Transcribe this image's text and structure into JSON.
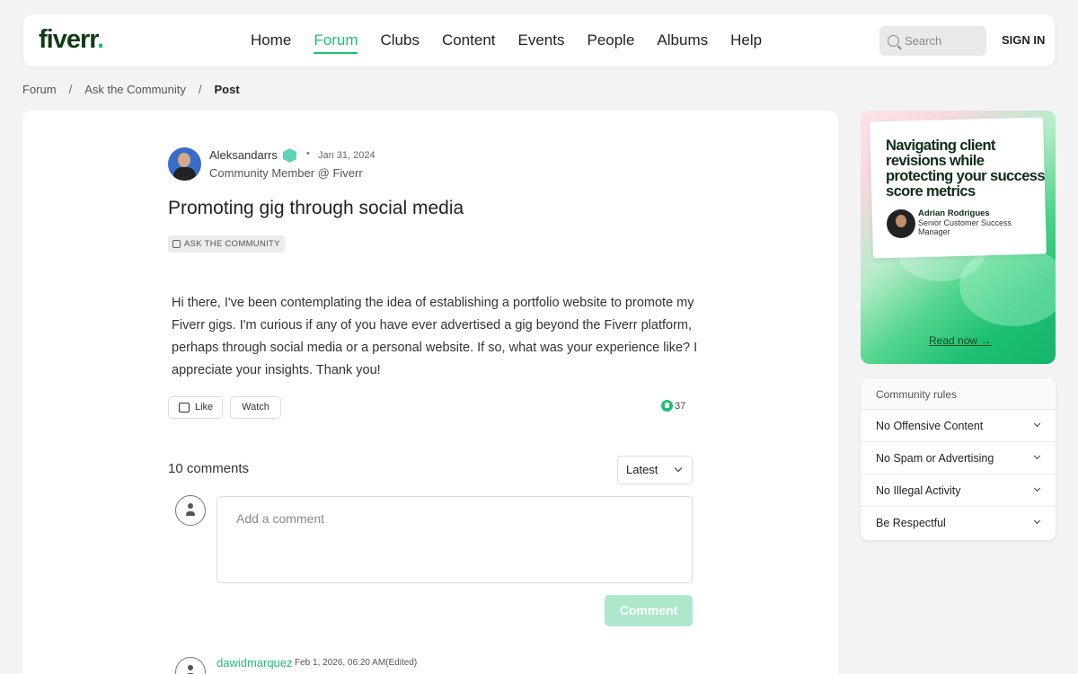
{
  "header": {
    "logo": "fiverr",
    "logo_dot": ".",
    "nav": [
      "Home",
      "Forum",
      "Clubs",
      "Content",
      "Events",
      "People",
      "Albums",
      "Help"
    ],
    "active_nav": "Forum",
    "search_placeholder": "Search",
    "signin": "SIGN IN"
  },
  "breadcrumb": {
    "items": [
      "Forum",
      "Ask the Community",
      "Post"
    ],
    "separator": "/"
  },
  "post": {
    "author": "Aleksandarrs",
    "dot": "•",
    "date": "Jan 31, 2024",
    "role": "Community Member @ Fiverr",
    "title": "Promoting gig through social media",
    "tag": "ASK THE COMMUNITY",
    "body": "Hi there, I've been contemplating the idea of establishing a portfolio website to promote my Fiverr gigs. I'm curious if any of you have ever advertised a gig beyond the Fiverr platform, perhaps through social media or a personal website. If so, what was your experience like? I appreciate your insights. Thank you!",
    "like_label": "Like",
    "watch_label": "Watch",
    "reaction_count": "37"
  },
  "comments": {
    "count_label": "10 comments",
    "sort": "Latest",
    "placeholder": "Add a comment",
    "submit": "Comment",
    "first": {
      "user": "dawidmarquez",
      "date": "Feb 1, 2026, 06:20 AM(Edited)"
    }
  },
  "promo": {
    "title": "Navigating client revisions while protecting your success score metrics",
    "author": "Adrian Rodrigues",
    "role": "Senior Customer Success Manager",
    "link": "Read now →"
  },
  "rules": {
    "heading": "Community rules",
    "items": [
      "No Offensive Content",
      "No Spam or Advertising",
      "No Illegal Activity",
      "Be Respectful"
    ]
  },
  "colors": {
    "brand_green": "#1dbf73",
    "logo_dark": "#123b14"
  },
  "icons": [
    "search-icon",
    "verified-badge-icon",
    "tag-icon",
    "like-icon",
    "reaction-icon",
    "chevron-down-icon",
    "user-avatar-icon"
  ]
}
